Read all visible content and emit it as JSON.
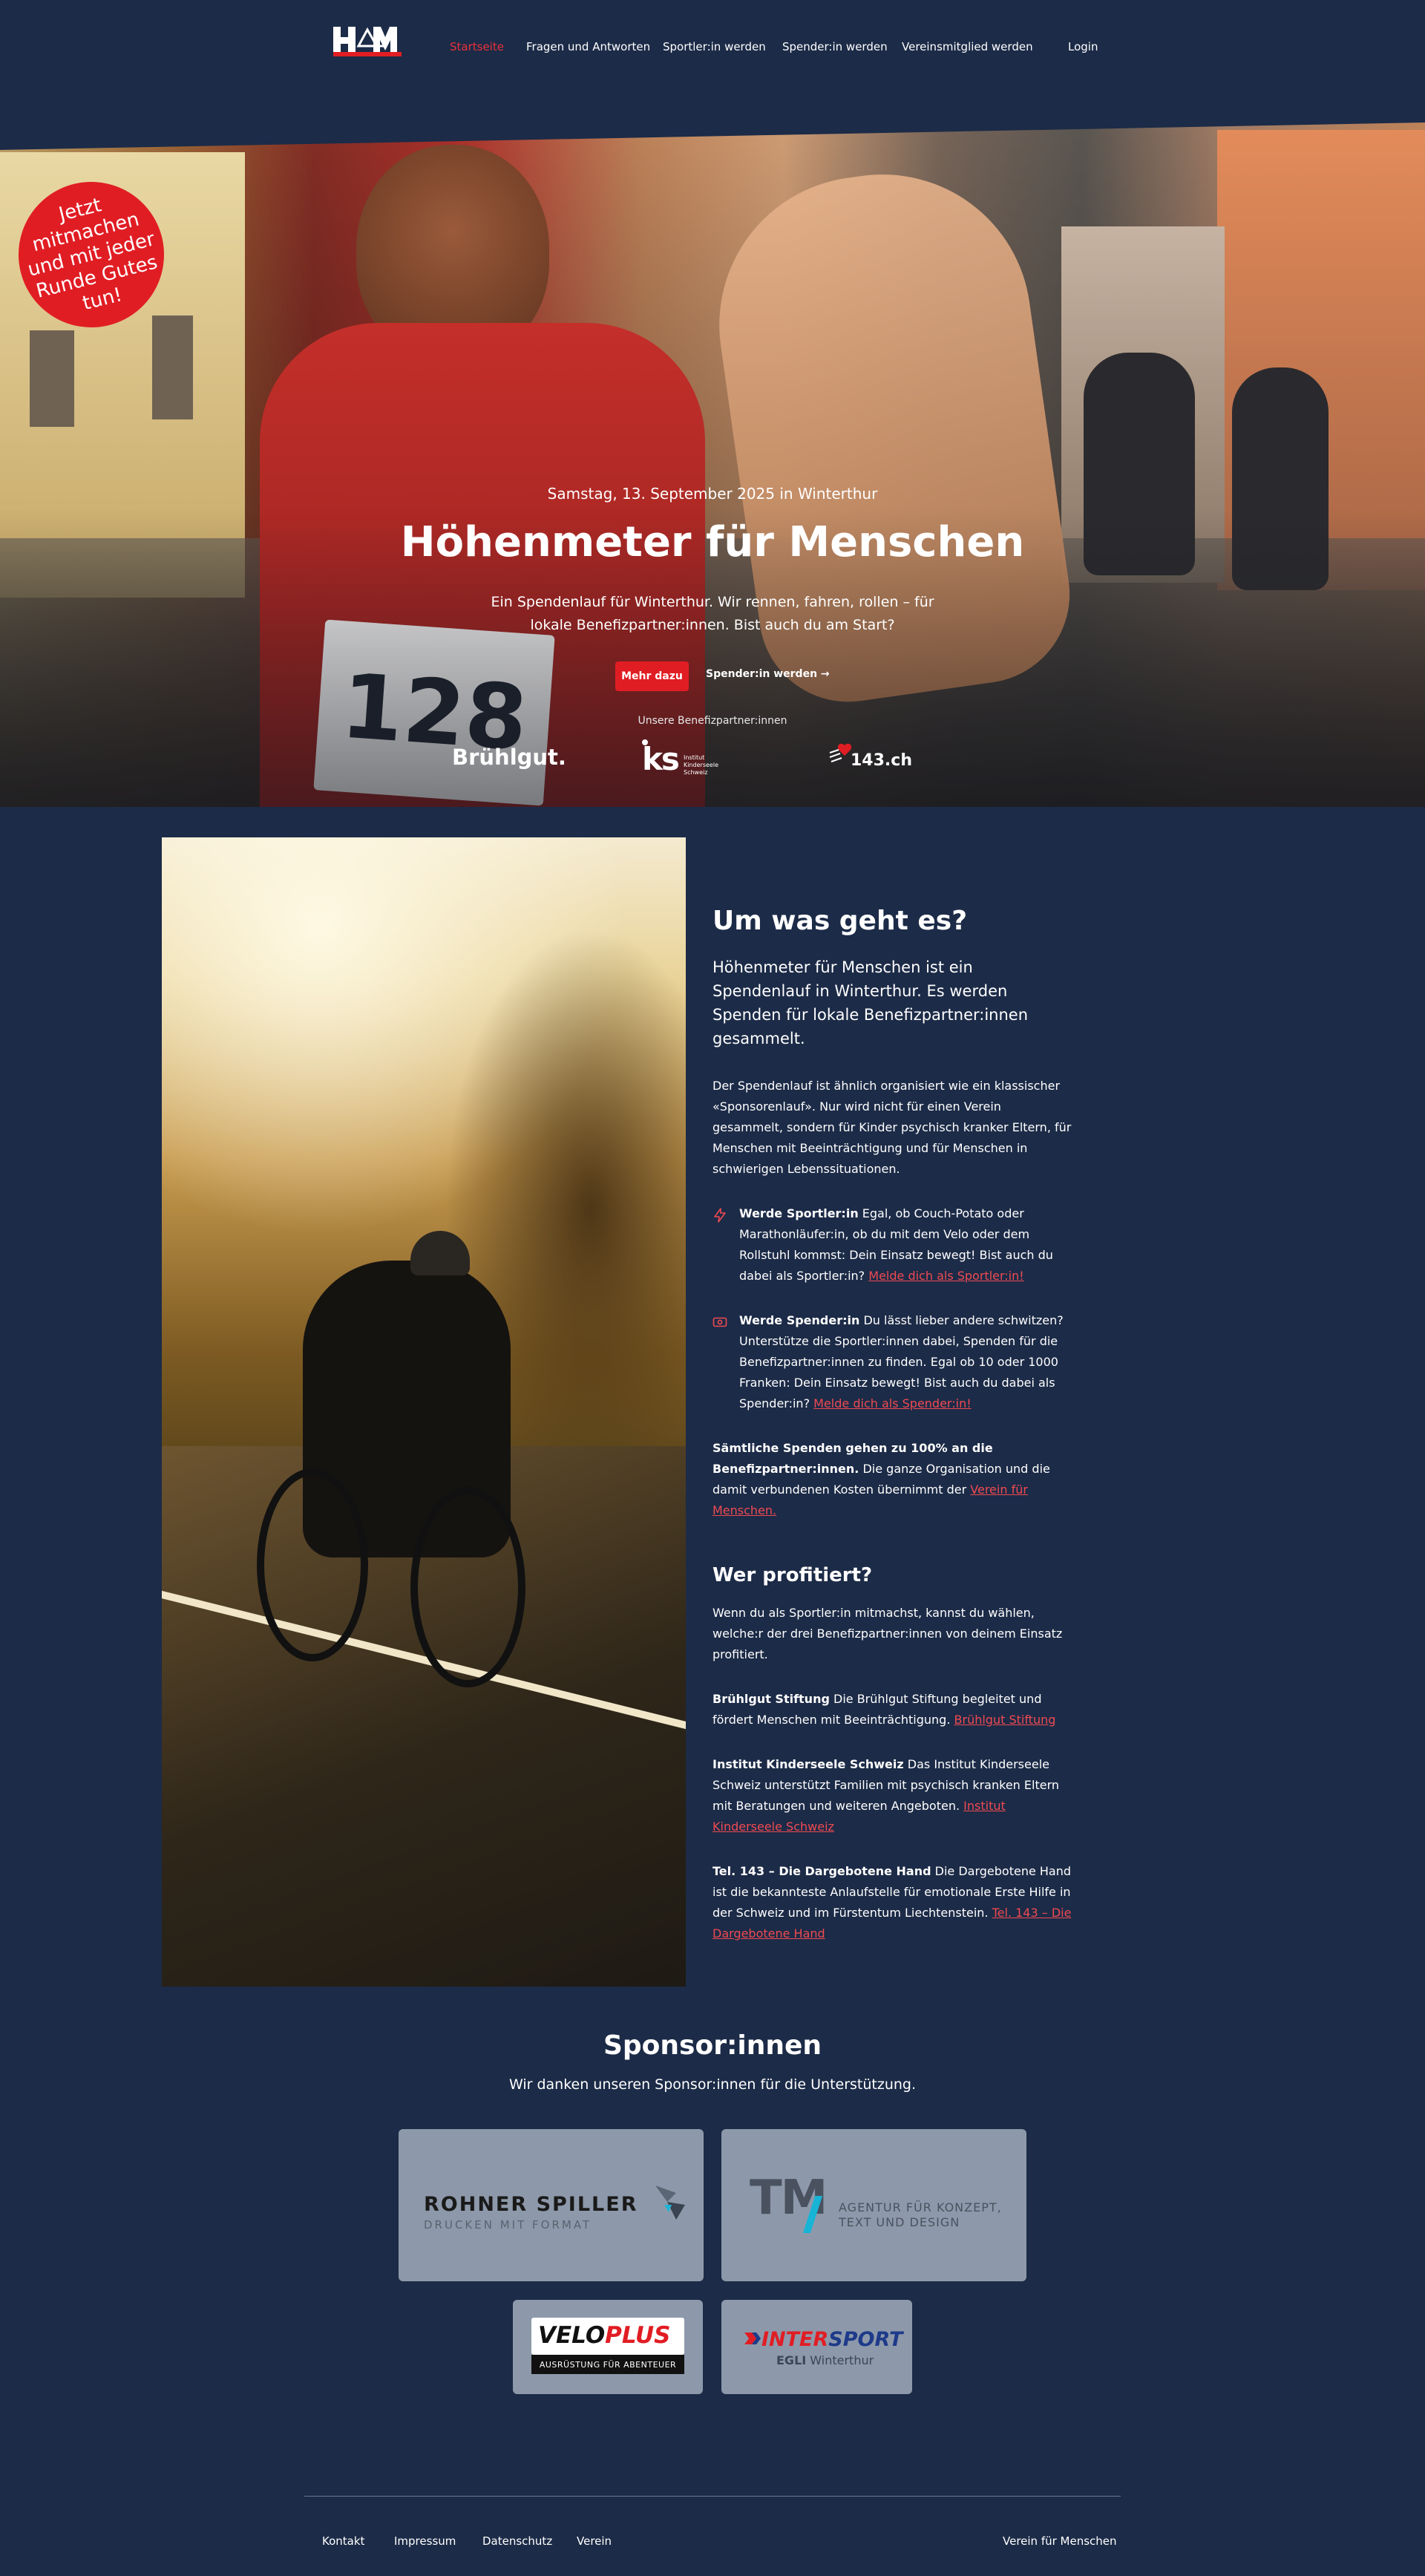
{
  "header": {
    "logo_text": "HfM",
    "nav": [
      {
        "label": "Startseite",
        "active": true
      },
      {
        "label": "Fragen und Antworten",
        "active": false
      },
      {
        "label": "Sportler:in werden",
        "active": false
      },
      {
        "label": "Spender:in werden",
        "active": false
      },
      {
        "label": "Vereinsmitglied werden",
        "active": false
      }
    ],
    "login": "Login"
  },
  "hero": {
    "badge": "Jetzt mitmachen und mit jeder Runde Gutes tun!",
    "date": "Samstag, 13. September 2025 in Winterthur",
    "title": "Höhenmeter für Menschen",
    "subtitle": "Ein Spendenlauf für Winterthur. Wir rennen, fahren, rollen – für lokale Benefizpartner:innen. Bist auch du am Start?",
    "bib_number": "128",
    "cta_primary": "Mehr dazu",
    "cta_secondary": "Spender:in werden →",
    "partners_label": "Unsere Benefizpartner:innen",
    "partners": {
      "bruehlgut": "Brühlgut.",
      "iks_mark": "ks",
      "iks_text_1": "Institut",
      "iks_text_2": "Kinderseele",
      "iks_text_3": "Schweiz",
      "tel143": "143.ch"
    }
  },
  "about": {
    "title": "Um was geht es?",
    "lead": "Höhenmeter für Menschen ist ein Spendenlauf in Winterthur. Es werden Spenden für lokale Benefizpartner:innen gesammelt.",
    "intro": "Der Spendenlauf ist ähnlich organisiert wie ein klassischer «Sponsorenlauf». Nur wird nicht für einen Verein gesammelt, sondern für Kinder psychisch kranker Eltern, für Menschen mit Beeinträchtigung und für Menschen in schwierigen Lebenssituationen.",
    "athlete": {
      "title": "Werde Sportler:in",
      "text": " Egal, ob Couch-Potato oder Marathonläufer:in, ob du mit dem Velo oder dem Rollstuhl kommst: Dein Einsatz bewegt! Bist auch du dabei als Sportler:in? ",
      "link": "Melde dich als Sportler:in!"
    },
    "donor": {
      "title": "Werde Spender:in",
      "text": " Du lässt lieber andere schwitzen? Unterstütze die Sportler:innen dabei, Spenden für die Benefizpartner:innen zu finden. Egal ob 10 oder 1000 Franken: Dein Einsatz bewegt! Bist auch du dabei als Spender:in? ",
      "link": "Melde dich als Spender:in!"
    },
    "donations_bold": "Sämtliche Spenden gehen zu 100% an die Benefizpartner:innen.",
    "donations_text": " Die ganze Organisation und die damit verbundenen Kosten übernimmt der ",
    "donations_link": "Verein für Menschen."
  },
  "beneficiaries": {
    "title": "Wer profitiert?",
    "intro": "Wenn du als Sportler:in mitmachst, kannst du wählen, welche:r der drei Benefizpartner:innen von deinem Einsatz profitiert.",
    "items": [
      {
        "name": "Brühlgut Stiftung",
        "text": " Die Brühlgut Stiftung begleitet und fördert Menschen mit Beeinträchtigung. ",
        "link": "Brühlgut Stiftung"
      },
      {
        "name": "Institut Kinderseele Schweiz",
        "text": " Das Institut Kinderseele Schweiz unterstützt Familien mit psychisch kranken Eltern mit Beratungen und weiteren Angeboten. ",
        "link": "Institut Kinderseele Schweiz"
      },
      {
        "name": "Tel. 143 – Die Dargebotene Hand",
        "text": " Die Dargebotene Hand ist die bekannteste Anlaufstelle für emotionale Erste Hilfe in der Schweiz und im Fürstentum Liechtenstein. ",
        "link": "Tel. 143 – Die Dargebotene Hand"
      }
    ]
  },
  "sponsors": {
    "title": "Sponsor:innen",
    "subtitle": "Wir danken unseren Sponsor:innen für die Unterstützung.",
    "rohner": {
      "name": "ROHNER SPILLER",
      "tagline": "DRUCKEN MIT FORMAT"
    },
    "tm": {
      "mark": "TM",
      "line1": "AGENTUR FÜR KONZEPT,",
      "line2": "TEXT UND DESIGN"
    },
    "veloplus": {
      "name_a": "VELO",
      "name_b": "PLUS",
      "tagline": "AUSRÜSTUNG FÜR ABENTEUER"
    },
    "intersport": {
      "name_a": "INTER",
      "name_b": "SPORT",
      "sub_bold": "EGLI",
      "sub": " Winterthur"
    }
  },
  "footer": {
    "links": [
      "Kontakt",
      "Impressum",
      "Datenschutz",
      "Verein"
    ],
    "right": "Verein für Menschen"
  },
  "colors": {
    "background": "#1c2b47",
    "accent": "#e11d24",
    "link": "#ef4a52",
    "sponsor_card": "#8d99aa"
  }
}
